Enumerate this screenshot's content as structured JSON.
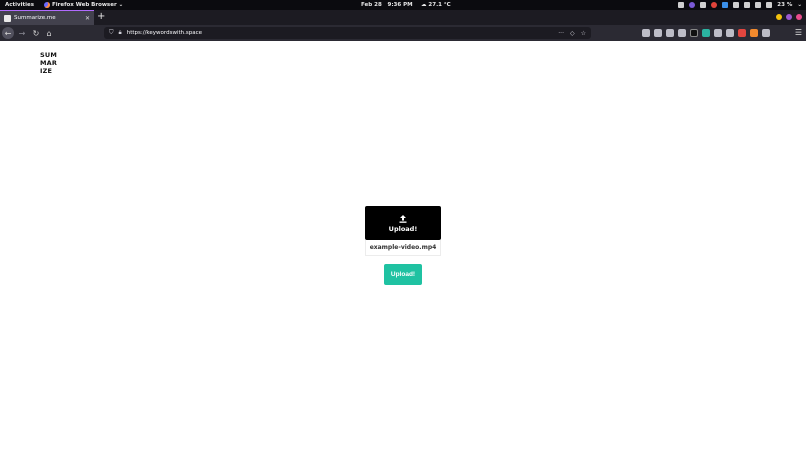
{
  "system_bar": {
    "activities": "Activities",
    "app_name": "Firefox Web Browser",
    "date": "Feb 28",
    "time": "9:36 PM",
    "weather": "27.1 °C",
    "battery": "23 %"
  },
  "browser": {
    "tab_title": "Summarize.me",
    "url": "https://keywordswith.space"
  },
  "page": {
    "logo_lines": [
      "SUM",
      "MAR",
      "IZE"
    ],
    "upload_box_label": "Upload!",
    "file_name": "example-video.mp4",
    "submit_label": "Upload!"
  },
  "colors": {
    "submit_button": "#1fc2a2",
    "upload_box": "#000000"
  },
  "icons": {
    "upload": "upload-icon",
    "back": "arrow-left-icon",
    "forward": "arrow-right-icon",
    "reload": "reload-icon",
    "home": "home-icon"
  }
}
